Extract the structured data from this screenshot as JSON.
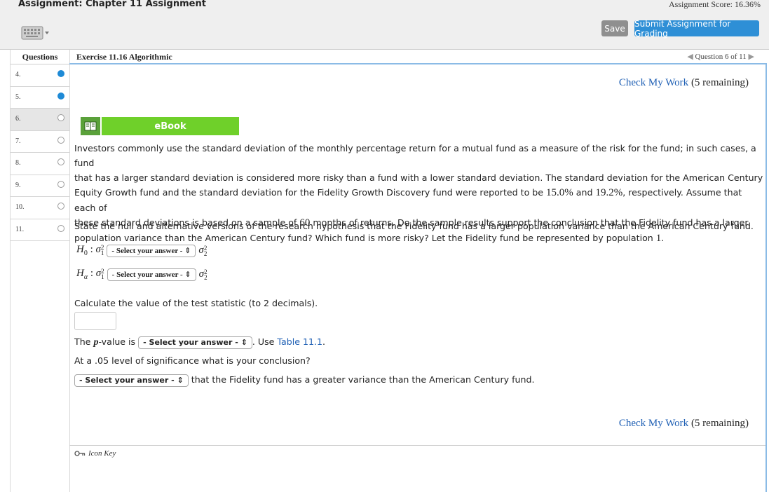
{
  "header": {
    "title": "Assignment: Chapter 11 Assignment",
    "score": "Assignment Score: 16.36%",
    "save_label": "Save",
    "submit_label": "Submit Assignment for Grading"
  },
  "sidebar": {
    "heading": "Questions",
    "items": [
      {
        "label": "4.",
        "status": "answered"
      },
      {
        "label": "5.",
        "status": "answered"
      },
      {
        "label": "6.",
        "status": "current"
      },
      {
        "label": "7.",
        "status": "open"
      },
      {
        "label": "8.",
        "status": "open"
      },
      {
        "label": "9.",
        "status": "open"
      },
      {
        "label": "10.",
        "status": "open"
      },
      {
        "label": "11.",
        "status": "open"
      }
    ]
  },
  "exercise": {
    "title": "Exercise 11.16 Algorithmic",
    "nav": "Question 6 of 11"
  },
  "check_work": {
    "link": "Check My Work",
    "remaining": "(5 remaining)"
  },
  "ebook_label": "eBook",
  "problem": {
    "p1": "Investors commonly use the standard deviation of the monthly percentage return for a mutual fund as a measure of the risk for the fund; in such cases, a fund",
    "p2": "that has a larger standard deviation is considered more risky than a fund with a lower standard deviation. The standard deviation for the American Century",
    "p3a": "Equity Growth fund and the standard deviation for the Fidelity Growth Discovery fund were reported to be ",
    "v1": "15.0%",
    "p3b": " and ",
    "v2": "19.2%",
    "p3c": ", respectively. Assume that each of",
    "p4a": "these standard deviations is based on a sample of ",
    "v3": "60",
    "p4b": " months of returns. Do the sample results support the conclusion that the Fidelity fund has a larger",
    "p5a": "population variance than the American Century fund? Which fund is more risky? Let the Fidelity fund be represented by population ",
    "v4": "1",
    "p5b": "."
  },
  "state_text": "State the null and alternative versions of the research hypothesis that the Fidelity fund has a larger population variance than the American Century fund.",
  "hypotheses": {
    "h0_select": "- Select your answer -",
    "ha_select": "- Select your answer -"
  },
  "calc_text": "Calculate the value of the test statistic (to 2 decimals).",
  "tstat_value": "",
  "pvalue": {
    "prefix": "The ",
    "p": "p",
    "middle": "-value is",
    "select": "- Select your answer -",
    "use": ". Use ",
    "table_link": "Table 11.1",
    "end": "."
  },
  "level_text": "At a .05 level of significance what is your conclusion?",
  "conclusion": {
    "select": "- Select your answer -",
    "text": "that the Fidelity fund has a greater variance than the American Century fund."
  },
  "icon_key": "Icon Key",
  "colors": {
    "accent": "#2e8fd6",
    "ebook": "#6fd02a",
    "link": "#1e5fb4"
  }
}
